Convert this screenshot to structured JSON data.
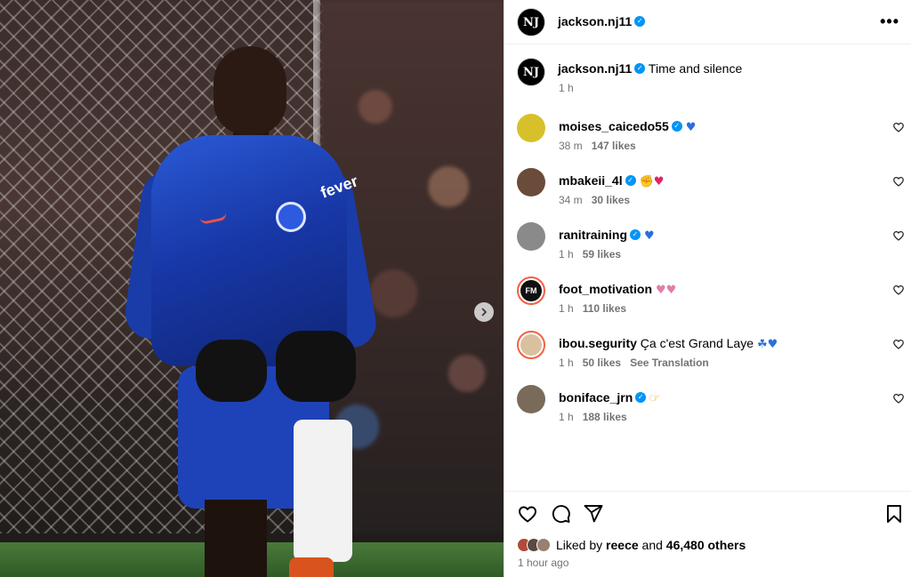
{
  "post": {
    "author": "jackson.nj11",
    "author_avatar_text": "NJ",
    "caption": "Time and silence",
    "caption_time": "1 h",
    "more_label": "•••"
  },
  "media": {
    "shirt_sponsor": "fever"
  },
  "comments": [
    {
      "user": "moises_caicedo55",
      "verified": true,
      "text": "",
      "emoji": "♥",
      "emoji_color": "#2a6fdb",
      "time": "38 m",
      "likes": "147 likes",
      "avatar_color": "#d7c02a"
    },
    {
      "user": "mbakeii_4l",
      "verified": true,
      "text": "",
      "emoji": "✊♥",
      "emoji_color": "#e0245e",
      "time": "34 m",
      "likes": "30 likes",
      "avatar_color": "#6b4b3a"
    },
    {
      "user": "ranitraining",
      "verified": true,
      "text": "",
      "emoji": "♥",
      "emoji_color": "#2a6fdb",
      "time": "1 h",
      "likes": "59 likes",
      "avatar_color": "#8a8a8a"
    },
    {
      "user": "foot_motivation",
      "verified": false,
      "text": "",
      "emoji": "♥♥",
      "emoji_color": "#e07fa8",
      "time": "1 h",
      "likes": "110 likes",
      "avatar_color": "#111111",
      "avatar_text": "FM"
    },
    {
      "user": "ibou.segurity",
      "verified": false,
      "text": "Ça c'est Grand Laye",
      "emoji": "☘♥",
      "emoji_color": "#2a6fdb",
      "time": "1 h",
      "likes": "50 likes",
      "translate": "See Translation",
      "avatar_color": "#d9c1a0"
    },
    {
      "user": "boniface_jrn",
      "verified": true,
      "text": "",
      "emoji": "☞",
      "emoji_color": "#e6a52a",
      "time": "1 h",
      "likes": "188 likes",
      "avatar_color": "#7a6a5a"
    }
  ],
  "likes_summary": {
    "prefix": "Liked by",
    "user": "reece",
    "middle": "and",
    "others": "46,480 others",
    "face_colors": [
      "#b04a3a",
      "#5a4a40",
      "#9a8070"
    ]
  },
  "posted_time": "1 hour ago",
  "colors": {
    "verified": "#0095f6",
    "secondary_text": "#737373",
    "divider": "#efefef"
  },
  "icons": {
    "like": "heart-icon",
    "comment": "comment-icon",
    "share": "paper-plane-icon",
    "save": "bookmark-icon",
    "next": "chevron-right-icon",
    "more": "more-horizontal-icon"
  }
}
